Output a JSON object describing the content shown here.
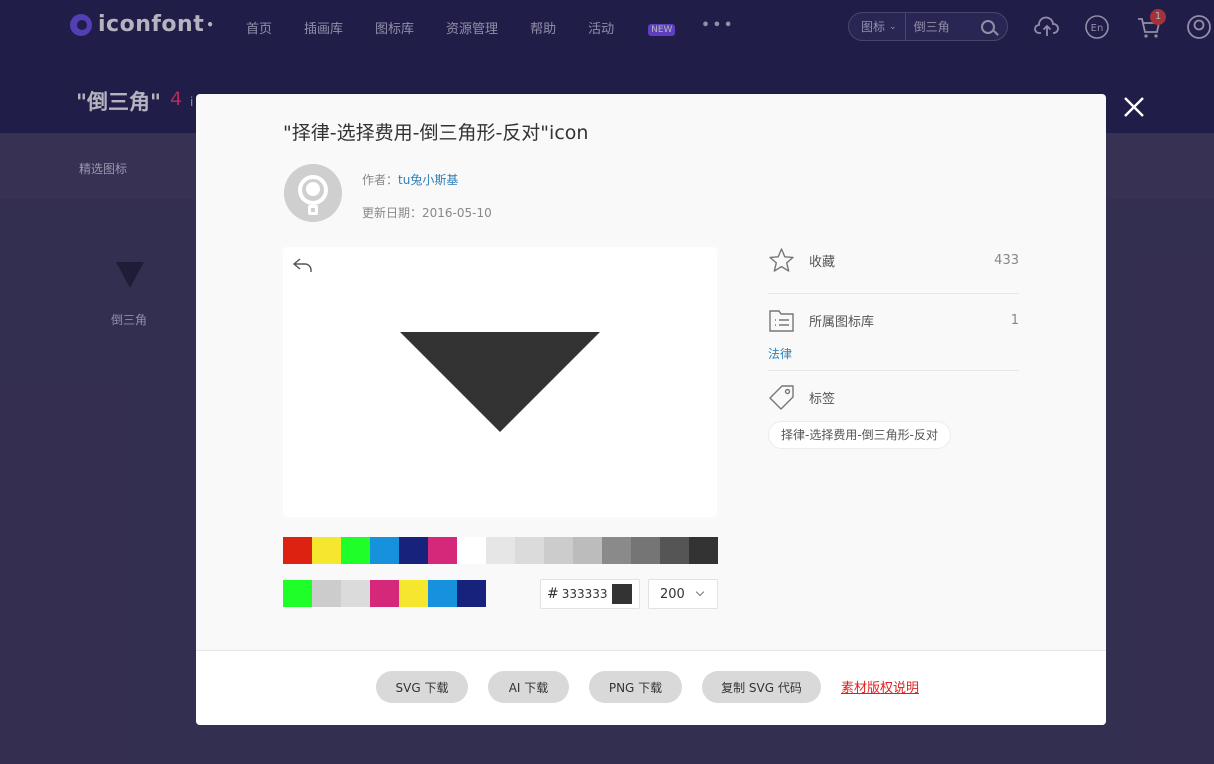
{
  "header": {
    "logo_text": "iconfont",
    "nav": [
      "首页",
      "插画库",
      "图标库",
      "资源管理",
      "帮助",
      "活动"
    ],
    "nav_badge": "NEW",
    "nav_more": "•••",
    "search_type": "图标",
    "search_value": "倒三角",
    "cart_count": "1",
    "lang_label": "En"
  },
  "page": {
    "heading": "\"倒三角\"",
    "count": "4",
    "count_suffix": "i",
    "filter_label": "精选图标",
    "result_icon_label": "倒三角"
  },
  "modal": {
    "title": "\"择律-选择费用-倒三角形-反对\"icon",
    "author_label": "作者：",
    "author_name": "tu兔小斯基",
    "date_label": "更新日期：",
    "date_value": "2016-05-10",
    "favorite_label": "收藏",
    "favorite_count": "433",
    "library_label": "所属图标库",
    "library_count": "1",
    "library_link": "法律",
    "tags_label": "标签",
    "tag": "择律-选择费用-倒三角形-反对",
    "palette_row1": [
      "#dd2211",
      "#f5e72e",
      "#1eff2a",
      "#1692dd",
      "#16227b",
      "#d6287a",
      "#ffffff",
      "#e6e6e6",
      "#dbdbdb",
      "#cccccc",
      "#bcbcbc",
      "#8a8a8a",
      "#757575",
      "#555555",
      "#333333"
    ],
    "palette_row2": [
      "#1eff2a",
      "#cccccc",
      "#dbdbdb",
      "#d6287a",
      "#f5e72e",
      "#1692dd",
      "#16227b"
    ],
    "hex_hash": "#",
    "hex_value": "333333",
    "icon_color": "#333333",
    "size_value": "200"
  },
  "footer": {
    "svg_download": "SVG 下载",
    "ai_download": "AI 下载",
    "png_download": "PNG 下载",
    "copy_svg": "复制 SVG 代码",
    "copyright": "素材版权说明"
  }
}
